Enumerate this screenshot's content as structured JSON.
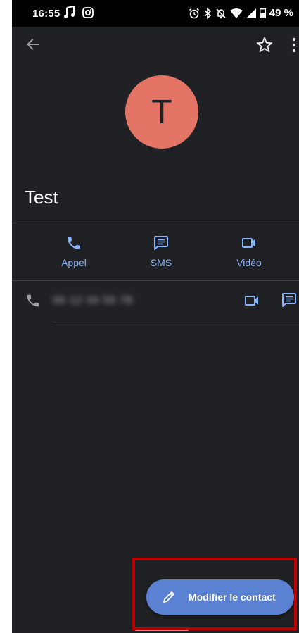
{
  "status_bar": {
    "time": "16:55",
    "battery_percent": "49 %",
    "icons": [
      "music-note-icon",
      "instagram-icon",
      "alarm-icon",
      "bluetooth-icon",
      "vibrate-off-icon",
      "wifi-icon",
      "signal-icon",
      "battery-icon"
    ]
  },
  "contact": {
    "initial": "T",
    "name": "Test",
    "phone_number": "06 12 34 56 78"
  },
  "actions": {
    "call_label": "Appel",
    "sms_label": "SMS",
    "video_label": "Vidéo"
  },
  "fab": {
    "label": "Modifier le contact"
  },
  "colors": {
    "background": "#202124",
    "accent": "#8ab4f8",
    "avatar": "#e47566",
    "fab": "#5b82d2",
    "highlight": "#c00000"
  }
}
